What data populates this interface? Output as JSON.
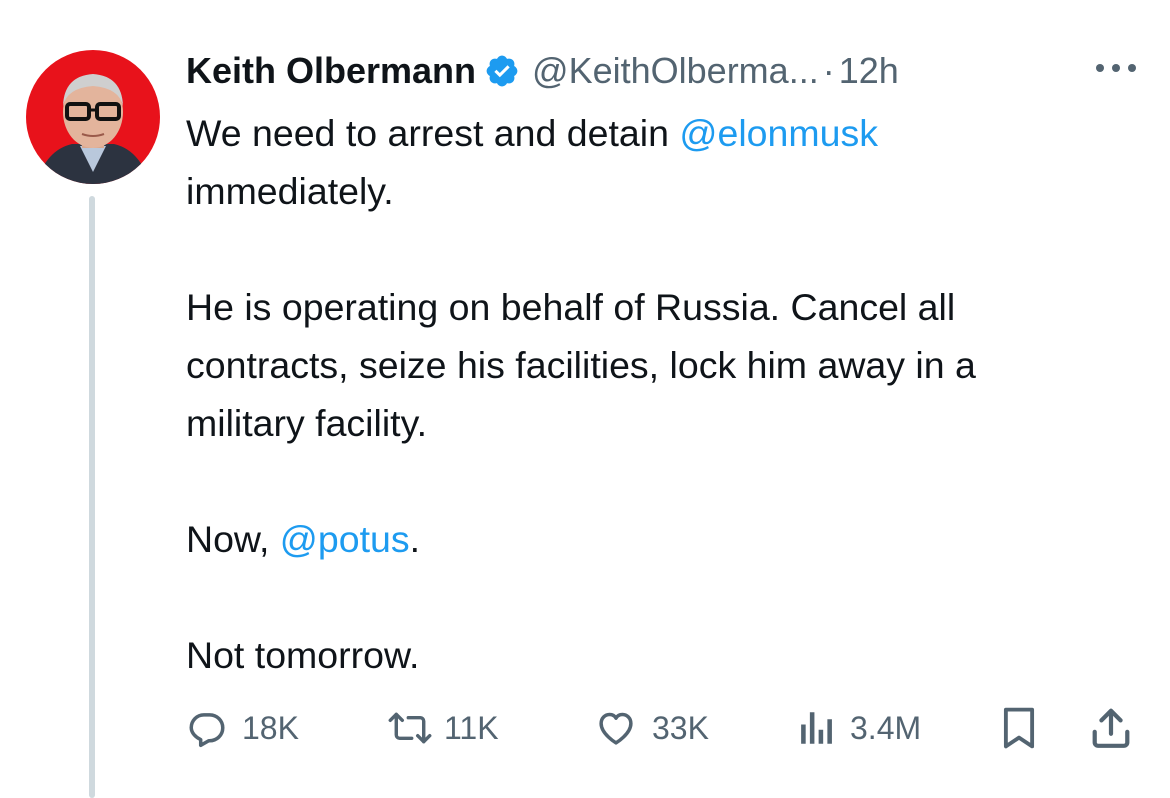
{
  "tweet": {
    "author_name": "Keith Olbermann",
    "handle": "@KeithOlberma...",
    "separator": "·",
    "time": "12h",
    "text_line1_prefix": "We need to arrest and detain ",
    "mention1": "@elonmusk",
    "text_line2": "immediately.",
    "paragraph2_line1": "He is operating on behalf of Russia. Cancel all",
    "paragraph2_line2": "contracts, seize his facilities, lock him away in a",
    "paragraph2_line3": "military facility.",
    "paragraph3_prefix": "Now, ",
    "mention2": "@potus",
    "paragraph3_suffix": ".",
    "paragraph4": "Not tomorrow."
  },
  "metrics": {
    "replies": "18K",
    "reposts": "11K",
    "likes": "33K",
    "views": "3.4M"
  },
  "icons": {
    "verified": "verified-badge-icon",
    "more": "more-icon",
    "reply": "reply-icon",
    "repost": "repost-icon",
    "like": "heart-icon",
    "views": "views-icon",
    "bookmark": "bookmark-icon",
    "share": "share-icon"
  },
  "colors": {
    "link": "#1d9bf0",
    "muted": "#536471",
    "text": "#0f1419",
    "avatar_bg": "#e8121b"
  }
}
